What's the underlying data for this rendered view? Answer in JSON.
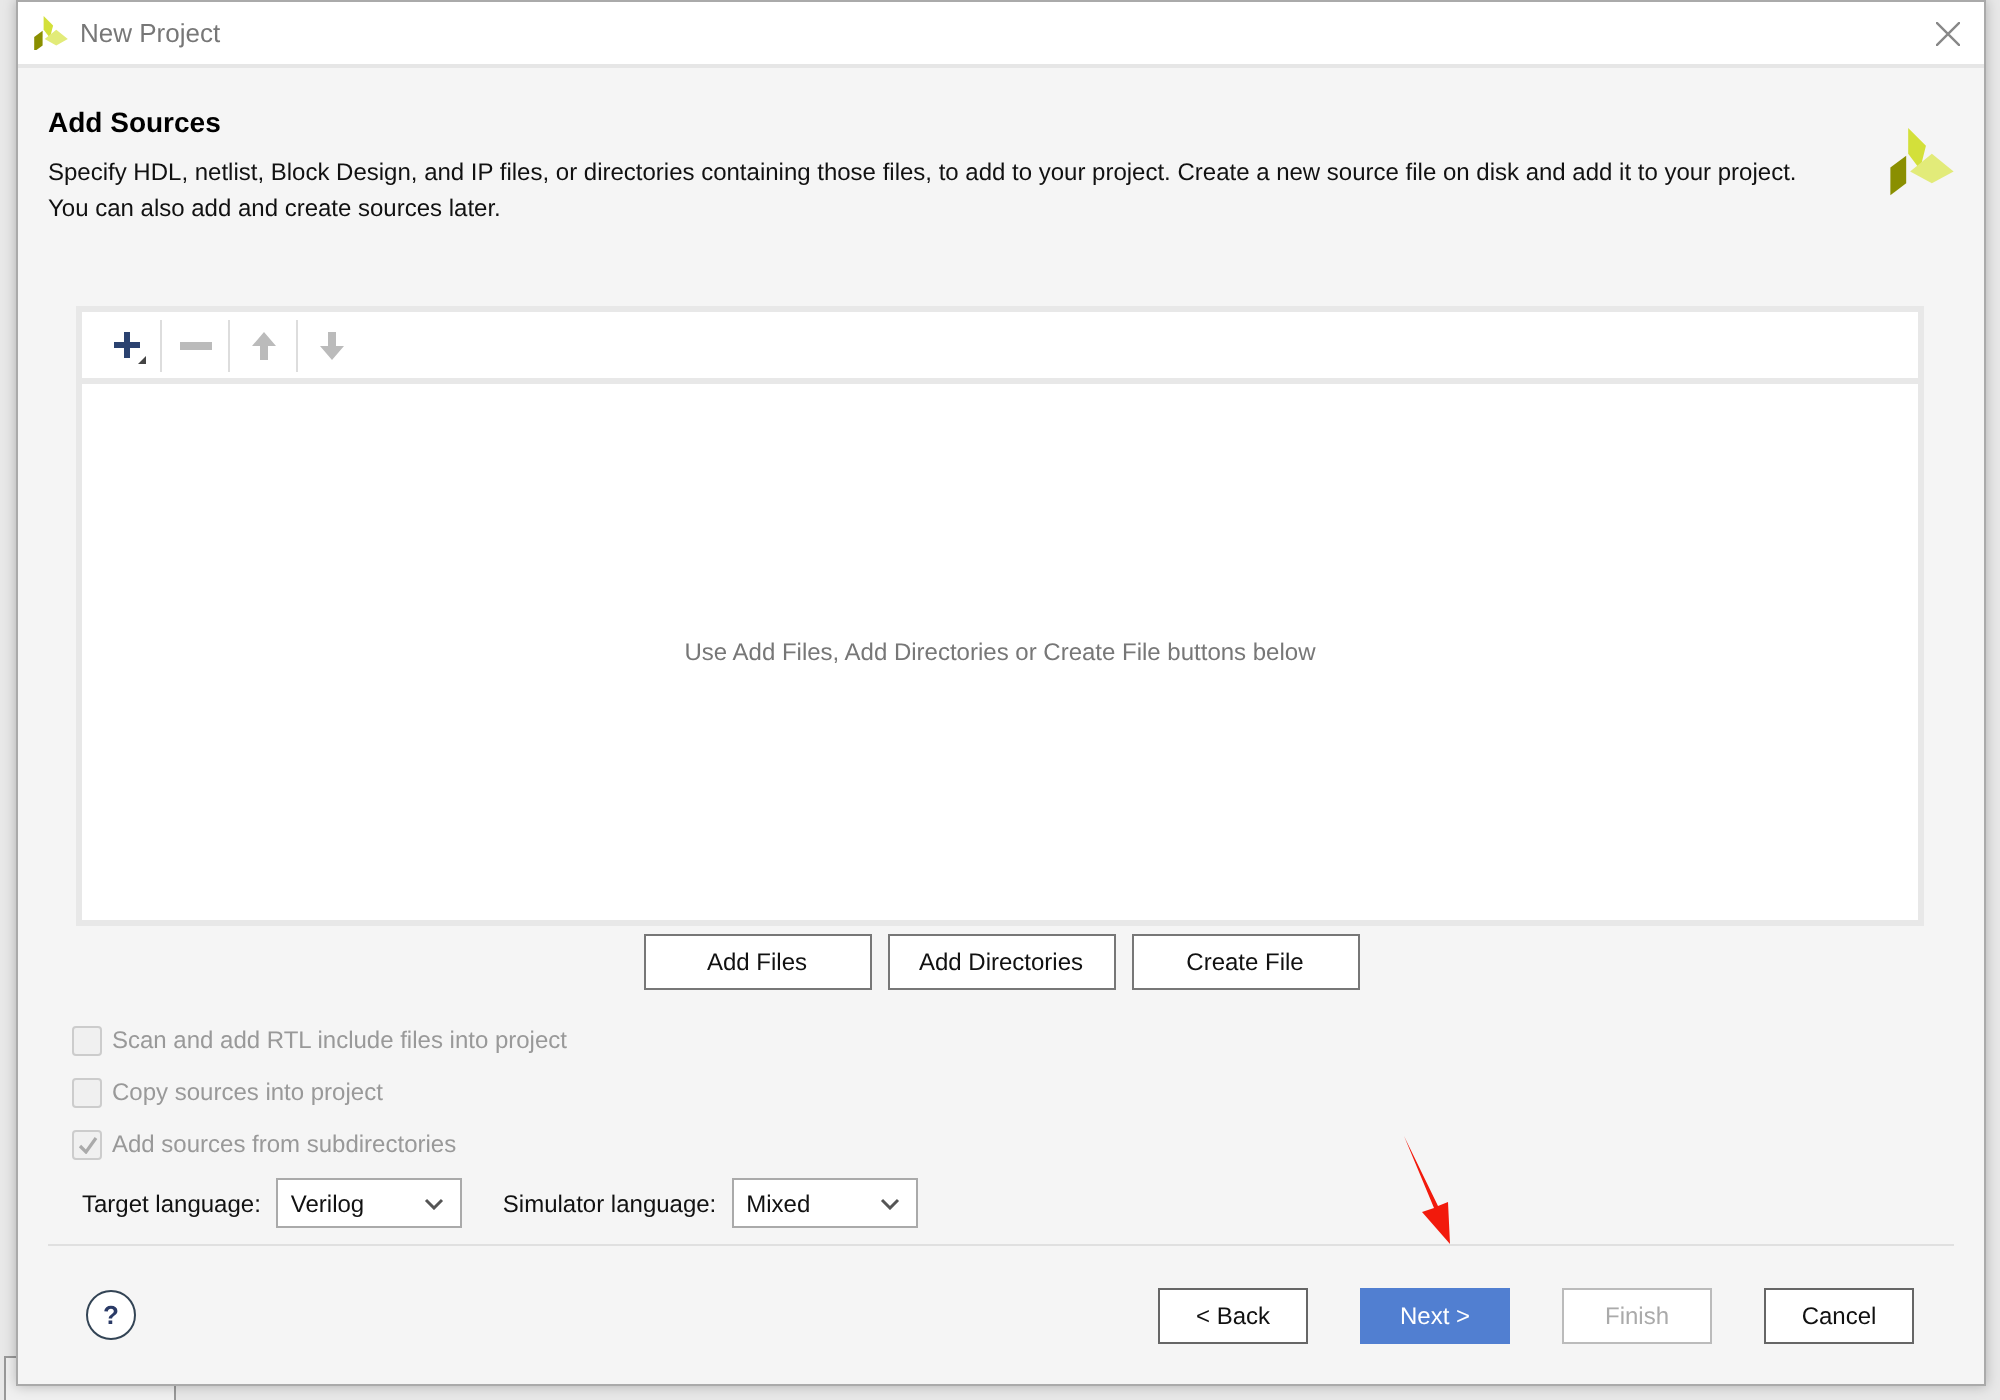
{
  "window": {
    "title": "New Project"
  },
  "page": {
    "heading": "Add Sources",
    "description": [
      "Specify HDL, netlist, Block Design, and IP files, or directories containing those files, to add to your project. Create a new source file on disk and add it to your project.",
      "You can also add and create sources later."
    ]
  },
  "sources": {
    "toolbar": [
      {
        "kind": "add",
        "disabled": false
      },
      {
        "kind": "remove",
        "disabled": true
      },
      {
        "kind": "up",
        "disabled": true
      },
      {
        "kind": "down",
        "disabled": true
      }
    ],
    "empty_message": "Use Add Files, Add Directories or Create File buttons below"
  },
  "source_buttons": [
    "Add Files",
    "Add Directories",
    "Create File"
  ],
  "options": [
    {
      "label": "Scan and add RTL include files into project",
      "checked": false,
      "disabled": true
    },
    {
      "label": "Copy sources into project",
      "checked": false,
      "disabled": true
    },
    {
      "label": "Add sources from subdirectories",
      "checked": true,
      "disabled": true
    }
  ],
  "languages": [
    {
      "label": "Target language:",
      "value": "Verilog"
    },
    {
      "label": "Simulator language:",
      "value": "Mixed"
    }
  ],
  "footer": {
    "help": "?",
    "buttons": [
      {
        "label": "< Back",
        "primary": false,
        "disabled": false
      },
      {
        "label": "Next >",
        "primary": true,
        "disabled": false
      },
      {
        "label": "Finish",
        "primary": false,
        "disabled": true
      },
      {
        "label": "Cancel",
        "primary": false,
        "disabled": false
      }
    ]
  }
}
